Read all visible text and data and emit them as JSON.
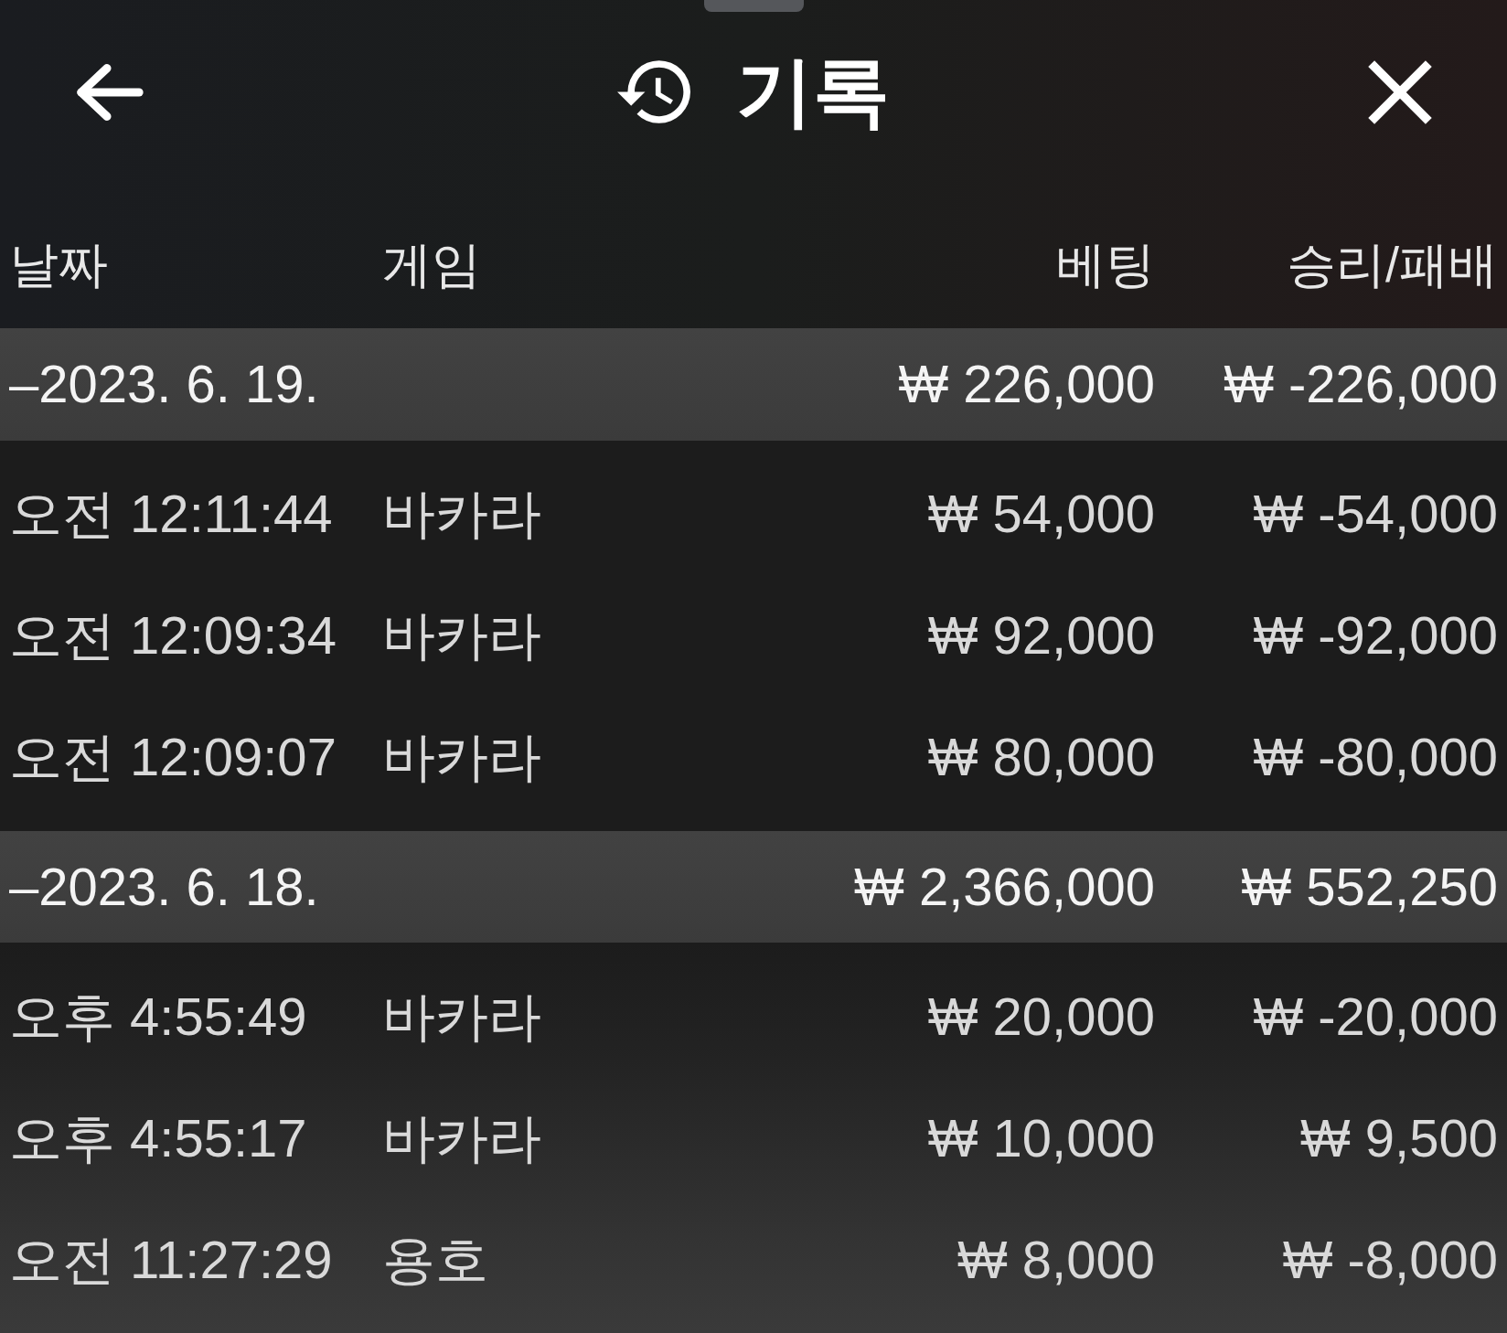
{
  "header": {
    "title": "기록"
  },
  "table": {
    "columns": [
      "날짜",
      "게임",
      "베팅",
      "승리/패배"
    ],
    "groups": [
      {
        "date": "–2023. 6. 19.",
        "bet": "₩ 226,000",
        "result": "₩ -226,000",
        "rows": [
          {
            "time": "오전 12:11:44",
            "game": "바카라",
            "bet": "₩ 54,000",
            "result": "₩ -54,000"
          },
          {
            "time": "오전 12:09:34",
            "game": "바카라",
            "bet": "₩ 92,000",
            "result": "₩ -92,000"
          },
          {
            "time": "오전 12:09:07",
            "game": "바카라",
            "bet": "₩ 80,000",
            "result": "₩ -80,000"
          }
        ]
      },
      {
        "date": "–2023. 6. 18.",
        "bet": "₩ 2,366,000",
        "result": "₩ 552,250",
        "rows": [
          {
            "time": "오후 4:55:49",
            "game": "바카라",
            "bet": "₩ 20,000",
            "result": "₩ -20,000"
          },
          {
            "time": "오후 4:55:17",
            "game": "바카라",
            "bet": "₩ 10,000",
            "result": "₩ 9,500"
          },
          {
            "time": "오전 11:27:29",
            "game": "용호",
            "bet": "₩ 8,000",
            "result": "₩ -8,000"
          }
        ]
      }
    ]
  }
}
